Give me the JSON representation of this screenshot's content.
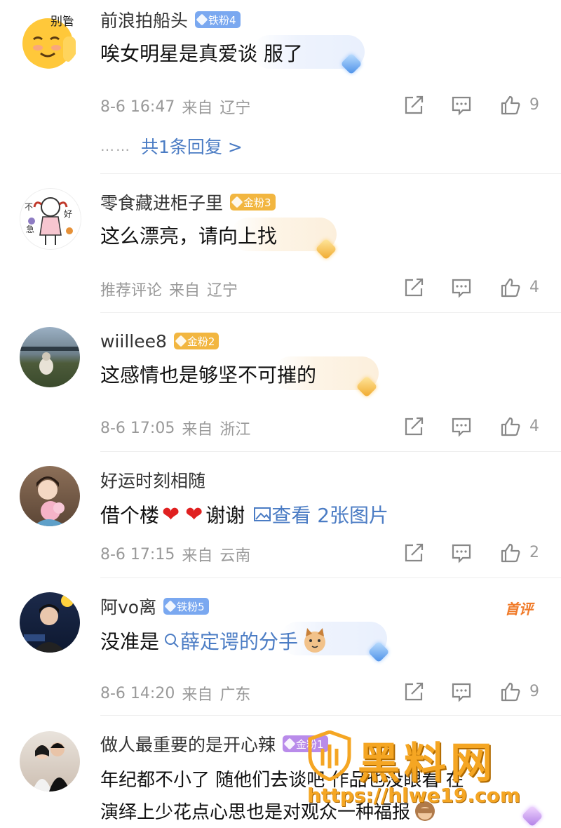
{
  "comments": [
    {
      "name": "前浪拍船头",
      "badge": {
        "type": "iron",
        "label": "铁粉4"
      },
      "text": "唉女明星是真爱谈 服了",
      "date": "8-6 16:47",
      "from": "来自",
      "location": "辽宁",
      "likes": "9",
      "reply_dots": "……",
      "reply_label": "共1条回复 >",
      "avatar_label": "别管"
    },
    {
      "name": "零食藏进柜子里",
      "badge": {
        "type": "gold",
        "label": "金粉3"
      },
      "text": "这么漂亮，请向上找",
      "date": "推荐评论",
      "from": "来自",
      "location": "辽宁",
      "likes": "4"
    },
    {
      "name": "wiillee8",
      "badge": {
        "type": "gold",
        "label": "金粉2"
      },
      "text": "这感情也是够坚不可摧的",
      "date": "8-6 17:05",
      "from": "来自",
      "location": "浙江",
      "likes": "4"
    },
    {
      "name": "好运时刻相随",
      "text_before": "借个楼",
      "text_after": "谢谢",
      "link_label": "查看 2张图片",
      "date": "8-6 17:15",
      "from": "来自",
      "location": "云南",
      "likes": "2"
    },
    {
      "name": "阿vo离",
      "badge": {
        "type": "iron",
        "label": "铁粉5"
      },
      "text_before": "没准是",
      "link_label": "薛定谔的分手",
      "date": "8-6 14:20",
      "from": "来自",
      "location": "广东",
      "likes": "9",
      "first_label": "首评"
    },
    {
      "name": "做人最重要的是开心辣",
      "badge": {
        "type": "gold",
        "label": "金粉1"
      },
      "line1": "年纪都不小了 随他们去谈吧 作品也没眼看 在",
      "line2": "演绎上少花点心思也是对观众一种福报"
    }
  ],
  "watermark": {
    "title": "黑料网",
    "url": "https://hlwe19.com"
  },
  "colors": {
    "link": "#4b7cc4",
    "badge_iron": "#7aa8f0",
    "badge_gold": "#f2b640",
    "first_label": "#f07b2a"
  }
}
